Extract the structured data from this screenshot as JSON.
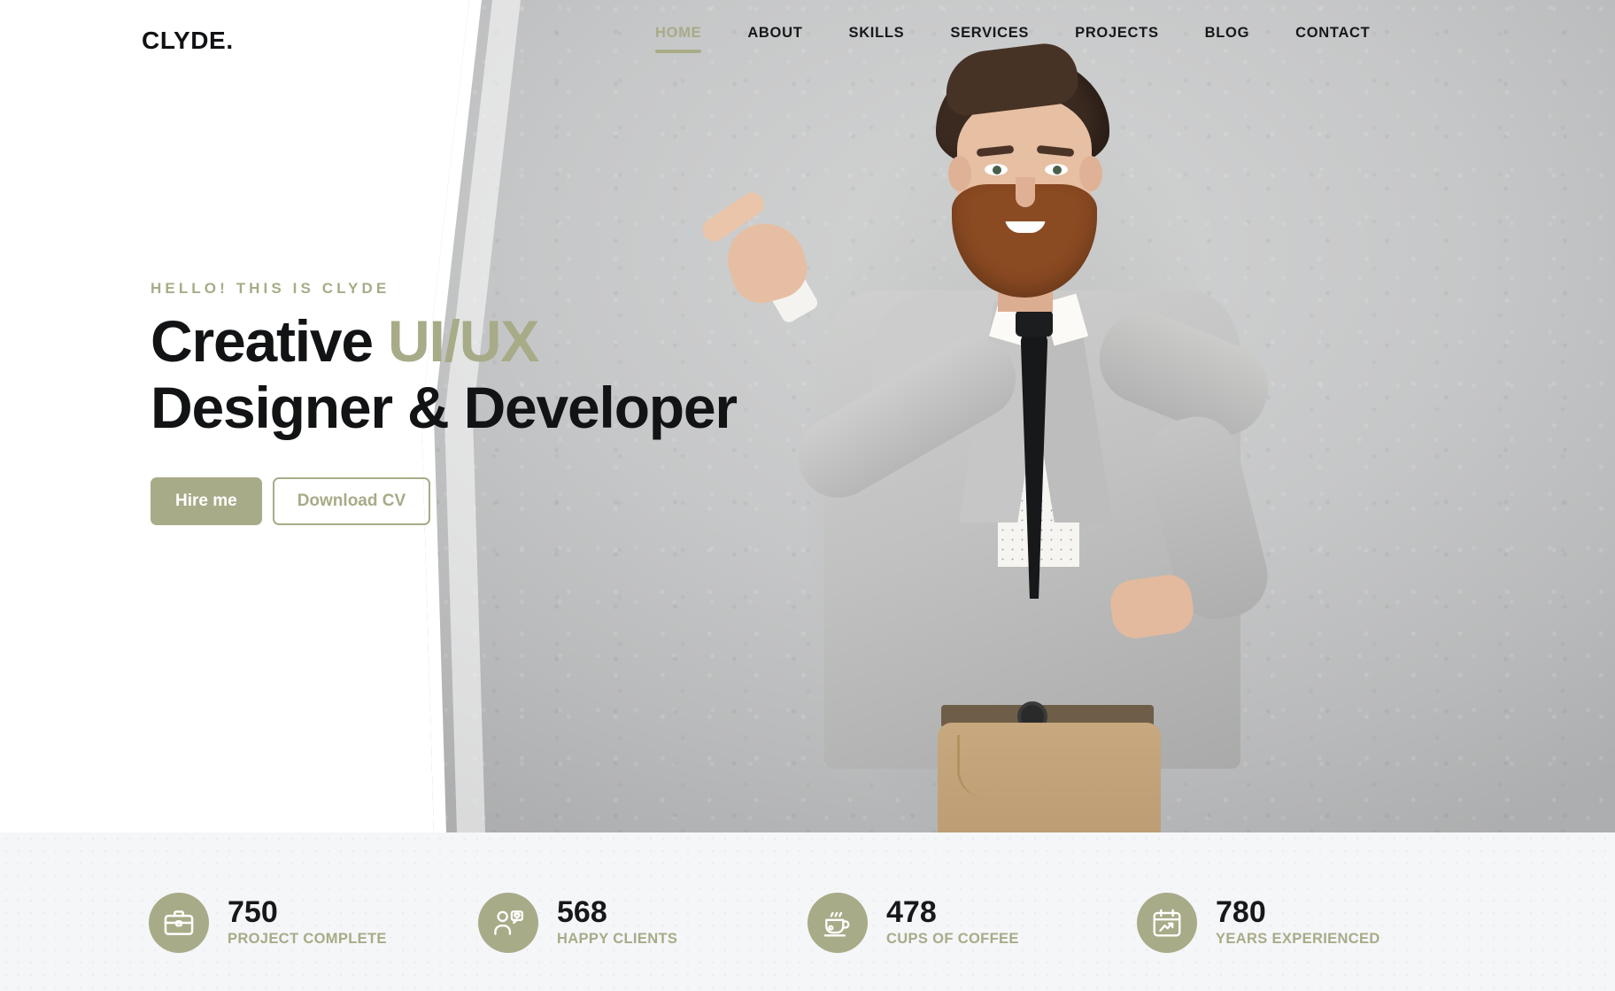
{
  "brand": {
    "logo": "CLYDE."
  },
  "nav": {
    "items": [
      {
        "label": "HOME",
        "active": true
      },
      {
        "label": "ABOUT",
        "active": false
      },
      {
        "label": "SKILLS",
        "active": false
      },
      {
        "label": "SERVICES",
        "active": false
      },
      {
        "label": "PROJECTS",
        "active": false
      },
      {
        "label": "BLOG",
        "active": false
      },
      {
        "label": "CONTACT",
        "active": false
      }
    ]
  },
  "hero": {
    "eyebrow": "HELLO! THIS IS CLYDE",
    "headline_line1_plain": "Creative ",
    "headline_line1_accent": "UI/UX",
    "headline_line2": "Designer & Developer",
    "primary_button": "Hire me",
    "secondary_button": "Download CV"
  },
  "stats": {
    "items": [
      {
        "value": "750",
        "label": "PROJECT COMPLETE",
        "icon": "briefcase-icon"
      },
      {
        "value": "568",
        "label": "HAPPY CLIENTS",
        "icon": "client-feedback-icon"
      },
      {
        "value": "478",
        "label": "CUPS OF COFFEE",
        "icon": "coffee-cup-icon"
      },
      {
        "value": "780",
        "label": "YEARS EXPERIENCED",
        "icon": "calendar-growth-icon"
      }
    ]
  },
  "colors": {
    "accent": "#a8ab87",
    "text_dark": "#16181a",
    "stats_background": "#f4f6f8",
    "photo_backdrop": "#c5c6c7"
  }
}
